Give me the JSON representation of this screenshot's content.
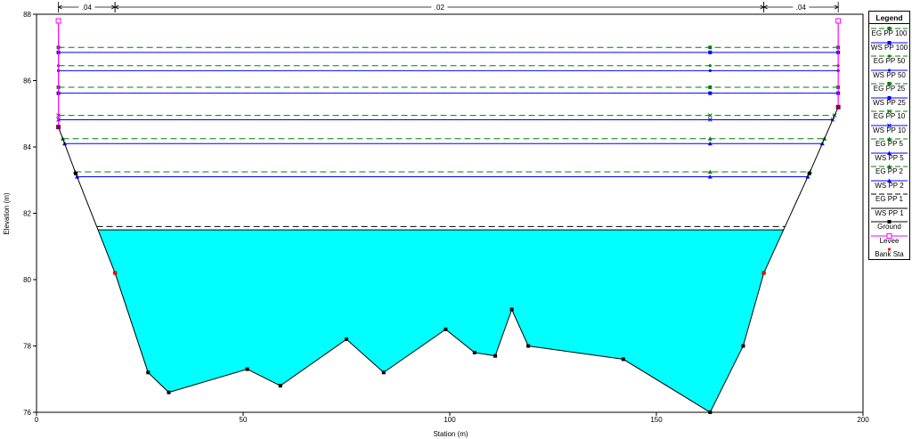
{
  "chart_data": {
    "type": "area",
    "xlabel": "Station (m)",
    "ylabel": "Elevation (m)",
    "xlim": [
      0,
      200
    ],
    "ylim": [
      76,
      88
    ],
    "x_ticks": [
      "0",
      "50",
      "100",
      "150",
      "200"
    ],
    "y_ticks": [
      "76",
      "78",
      "80",
      "82",
      "84",
      "86",
      "88"
    ],
    "mannings_n": [
      {
        "label": ".04",
        "from": 5.3,
        "to": 19
      },
      {
        "label": ".02",
        "from": 19,
        "to": 176
      },
      {
        "label": ".04",
        "from": 176,
        "to": 194
      }
    ],
    "ground": {
      "x": [
        5.3,
        9.5,
        19,
        27,
        32,
        51,
        59,
        75,
        84,
        99,
        106,
        111,
        115,
        119,
        142,
        163,
        171,
        176,
        187,
        194
      ],
      "y": [
        84.6,
        83.2,
        80.2,
        77.2,
        76.6,
        77.3,
        76.8,
        78.2,
        77.2,
        78.5,
        77.8,
        77.7,
        79.1,
        78.0,
        77.6,
        76.0,
        78.0,
        80.2,
        83.2,
        85.2
      ]
    },
    "left_levee": {
      "x": 5.3,
      "top": 87.8,
      "base": 84.6
    },
    "right_levee": {
      "x": 194,
      "top": 87.8,
      "base": 85.2
    },
    "bank_stations": [
      {
        "x": 19,
        "y": 80.2
      },
      {
        "x": 176,
        "y": 80.2
      }
    ],
    "water_surface_fill": {
      "series": "WS PP 1",
      "elevation": 81.5,
      "color": "#00ffff"
    },
    "profiles": [
      {
        "name": "EG PP 100",
        "kind": "EG",
        "elevation": 87.0,
        "marker": "square",
        "color": "#008000"
      },
      {
        "name": "WS PP 100",
        "kind": "WS",
        "elevation": 86.85,
        "marker": "square",
        "color": "#0000ff"
      },
      {
        "name": "EG PP 50",
        "kind": "EG",
        "elevation": 86.45,
        "marker": "dot",
        "color": "#008000"
      },
      {
        "name": "WS PP 50",
        "kind": "WS",
        "elevation": 86.3,
        "marker": "dot",
        "color": "#0000ff"
      },
      {
        "name": "EG PP 25",
        "kind": "EG",
        "elevation": 85.8,
        "marker": "square",
        "color": "#008000"
      },
      {
        "name": "WS PP 25",
        "kind": "WS",
        "elevation": 85.62,
        "marker": "square",
        "color": "#0000ff"
      },
      {
        "name": "EG PP 10",
        "kind": "EG",
        "elevation": 84.95,
        "marker": "x",
        "color": "#008000"
      },
      {
        "name": "WS PP 10",
        "kind": "WS",
        "elevation": 84.82,
        "marker": "x",
        "color": "#0000ff"
      },
      {
        "name": "EG PP 5",
        "kind": "EG",
        "elevation": 84.25,
        "marker": "triangle",
        "color": "#008000"
      },
      {
        "name": "WS PP 5",
        "kind": "WS",
        "elevation": 84.1,
        "marker": "triangle",
        "color": "#0000ff"
      },
      {
        "name": "EG PP 2",
        "kind": "EG",
        "elevation": 83.25,
        "marker": "triangle",
        "color": "#008000"
      },
      {
        "name": "WS PP 2",
        "kind": "WS",
        "elevation": 83.1,
        "marker": "triangle",
        "color": "#0000ff"
      },
      {
        "name": "EG PP 1",
        "kind": "EG",
        "elevation": 81.6,
        "marker": "none",
        "color": "#000000"
      },
      {
        "name": "WS PP 1",
        "kind": "WS",
        "elevation": 81.5,
        "marker": "none",
        "color": "#000000"
      }
    ],
    "marker_stations": [
      5.3,
      163,
      194
    ]
  },
  "legend": {
    "title": "Legend",
    "items": [
      {
        "label": "EG PP 100",
        "style": "dashed",
        "color": "#008000",
        "marker": "square"
      },
      {
        "label": "WS PP 100",
        "style": "solid",
        "color": "#0000ff",
        "marker": "square"
      },
      {
        "label": "EG PP 50",
        "style": "dashed",
        "color": "#008000",
        "marker": "dot"
      },
      {
        "label": "WS PP 50",
        "style": "solid",
        "color": "#0000ff",
        "marker": "dot"
      },
      {
        "label": "EG PP 25",
        "style": "dashed",
        "color": "#008000",
        "marker": "square"
      },
      {
        "label": "WS PP 25",
        "style": "solid",
        "color": "#0000ff",
        "marker": "square"
      },
      {
        "label": "EG PP 10",
        "style": "dashed",
        "color": "#008000",
        "marker": "x"
      },
      {
        "label": "WS PP 10",
        "style": "solid",
        "color": "#0000ff",
        "marker": "x"
      },
      {
        "label": "EG PP 5",
        "style": "dashed",
        "color": "#008000",
        "marker": "triangle"
      },
      {
        "label": "WS PP 5",
        "style": "solid",
        "color": "#0000ff",
        "marker": "triangle"
      },
      {
        "label": "EG PP 2",
        "style": "dashed",
        "color": "#008000",
        "marker": "triangle"
      },
      {
        "label": "WS PP 2",
        "style": "solid",
        "color": "#0000ff",
        "marker": "triangle"
      },
      {
        "label": "EG PP 1",
        "style": "dashed",
        "color": "#000000",
        "marker": "none"
      },
      {
        "label": "WS PP 1",
        "style": "solid",
        "color": "#000000",
        "marker": "none"
      },
      {
        "label": "Ground",
        "style": "solid",
        "color": "#000000",
        "marker": "square"
      },
      {
        "label": "Levee",
        "style": "solid",
        "color": "#ff00ff",
        "marker": "open-square"
      },
      {
        "label": "Bank Sta",
        "style": "none",
        "color": "#ff0000",
        "marker": "dot"
      }
    ]
  }
}
